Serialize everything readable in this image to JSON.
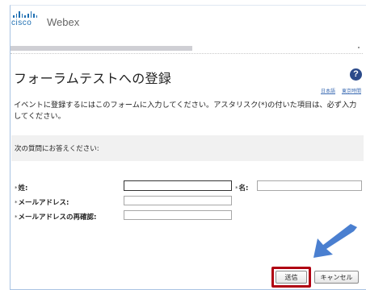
{
  "brand": {
    "cisco": "cisco",
    "product": "Webex"
  },
  "page": {
    "title": "フォーラムテストへの登録",
    "help_icon": "?",
    "links": [
      "日本語",
      "東京時間"
    ],
    "intro": "イベントに登録するにはこのフォームに入力してください。アスタリスク(*)の付いた項目は、必ず入力してください。"
  },
  "question": {
    "text": "次の質問にお答えください:"
  },
  "form": {
    "required_mark": "*",
    "last_name_label": "姓:",
    "first_name_label": "名:",
    "email_label": "メールアドレス:",
    "email_confirm_label": "メールアドレスの再確認:",
    "last_name_value": "",
    "first_name_value": "",
    "email_value": "",
    "email_confirm_value": ""
  },
  "buttons": {
    "submit": "送信",
    "cancel": "キャンセル"
  },
  "colors": {
    "arrow": "#4a7fd0",
    "highlight": "#b00012",
    "brand_blue": "#1f6fb2"
  }
}
